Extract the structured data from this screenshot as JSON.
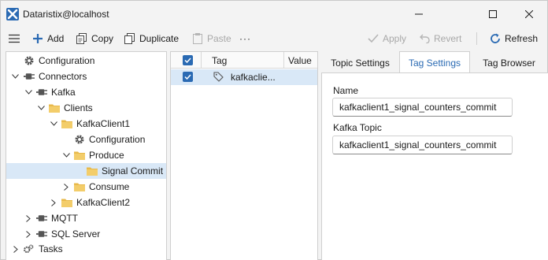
{
  "window": {
    "title": "Dataristix@localhost",
    "icons": {
      "app": "dataristix-logo-icon",
      "minimize": "minimize-icon",
      "maximize": "maximize-icon",
      "close": "close-icon"
    }
  },
  "toolbar": {
    "menu_icon": "hamburger-menu-icon",
    "add_label": "Add",
    "copy_label": "Copy",
    "duplicate_label": "Duplicate",
    "paste_label": "Paste",
    "more_label": "···",
    "apply_label": "Apply",
    "revert_label": "Revert",
    "refresh_label": "Refresh",
    "disabled": [
      "Paste",
      "Apply",
      "Revert"
    ]
  },
  "tree": {
    "items": [
      {
        "label": "Configuration",
        "icon": "gear-icon",
        "level": 0,
        "expanded": null
      },
      {
        "label": "Connectors",
        "icon": "plug-icon",
        "level": 0,
        "expanded": true
      },
      {
        "label": "Kafka",
        "icon": "plug-icon",
        "level": 1,
        "expanded": true
      },
      {
        "label": "Clients",
        "icon": "folder-icon",
        "level": 2,
        "expanded": true
      },
      {
        "label": "KafkaClient1",
        "icon": "folder-icon",
        "level": 3,
        "expanded": true
      },
      {
        "label": "Configuration",
        "icon": "gear-icon",
        "level": 4,
        "expanded": null
      },
      {
        "label": "Produce",
        "icon": "folder-icon",
        "level": 4,
        "expanded": true
      },
      {
        "label": "Signal Commit",
        "icon": "folder-icon",
        "level": 5,
        "expanded": null,
        "selected": true
      },
      {
        "label": "Consume",
        "icon": "folder-icon",
        "level": 4,
        "expanded": false
      },
      {
        "label": "KafkaClient2",
        "icon": "folder-icon",
        "level": 3,
        "expanded": false
      },
      {
        "label": "MQTT",
        "icon": "plug-icon",
        "level": 1,
        "expanded": false
      },
      {
        "label": "SQL Server",
        "icon": "plug-icon",
        "level": 1,
        "expanded": false
      },
      {
        "label": "Tasks",
        "icon": "gears-icon",
        "level": 0,
        "expanded": false
      }
    ]
  },
  "grid": {
    "columns": [
      "Tag",
      "Value"
    ],
    "rows": [
      {
        "checked": true,
        "tag": "kafkaclie...",
        "value": "",
        "icon": "tag-icon"
      }
    ],
    "header_checked": true
  },
  "details": {
    "tabs": [
      "Topic Settings",
      "Tag Settings",
      "Tag Browser"
    ],
    "active_tab": "Tag Settings",
    "name_label": "Name",
    "name_value": "kafkaclient1_signal_counters_commit",
    "topic_label": "Kafka Topic",
    "topic_value": "kafkaclient1_signal_counters_commit"
  },
  "colors": {
    "accent": "#2a6ab3",
    "selection": "#d9e8f7",
    "folder": "#e8b94a",
    "connector": "#5a5a5a"
  }
}
